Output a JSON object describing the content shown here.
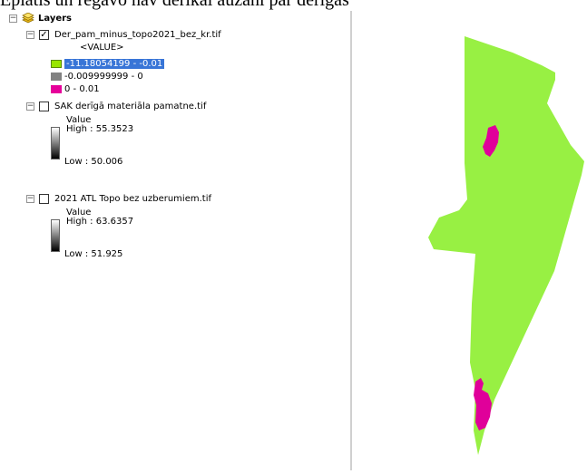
{
  "caption": "Epiatis un reģavo nav derīkai auzāni par derīgas",
  "toc": {
    "root": {
      "label": "Layers",
      "icon": "layers-icon"
    },
    "layers": [
      {
        "name": "Der_pam_minus_topo2021_bez_kr.tif",
        "checked": true,
        "field": "<VALUE>",
        "classes": [
          {
            "label": "-11.18054199 - -0.01",
            "color": "#98e600",
            "selected": true
          },
          {
            "label": "-0.009999999 - 0",
            "color": "#828282",
            "selected": false
          },
          {
            "label": "0 - 0.01",
            "color": "#e6009a",
            "selected": false
          }
        ]
      },
      {
        "name": "SAK derīgā materiāla pamatne.tif",
        "checked": false,
        "field": "Value",
        "high": "High : 55.3523",
        "low": "Low : 50.006"
      },
      {
        "name": "2021 ATL Topo bez uzberumiem.tif",
        "checked": false,
        "field": "Value",
        "high": "High : 63.6357",
        "low": "Low : 51.925"
      }
    ]
  },
  "map": {
    "fill_color": "#98f043",
    "highlight_color": "#e0009a"
  }
}
